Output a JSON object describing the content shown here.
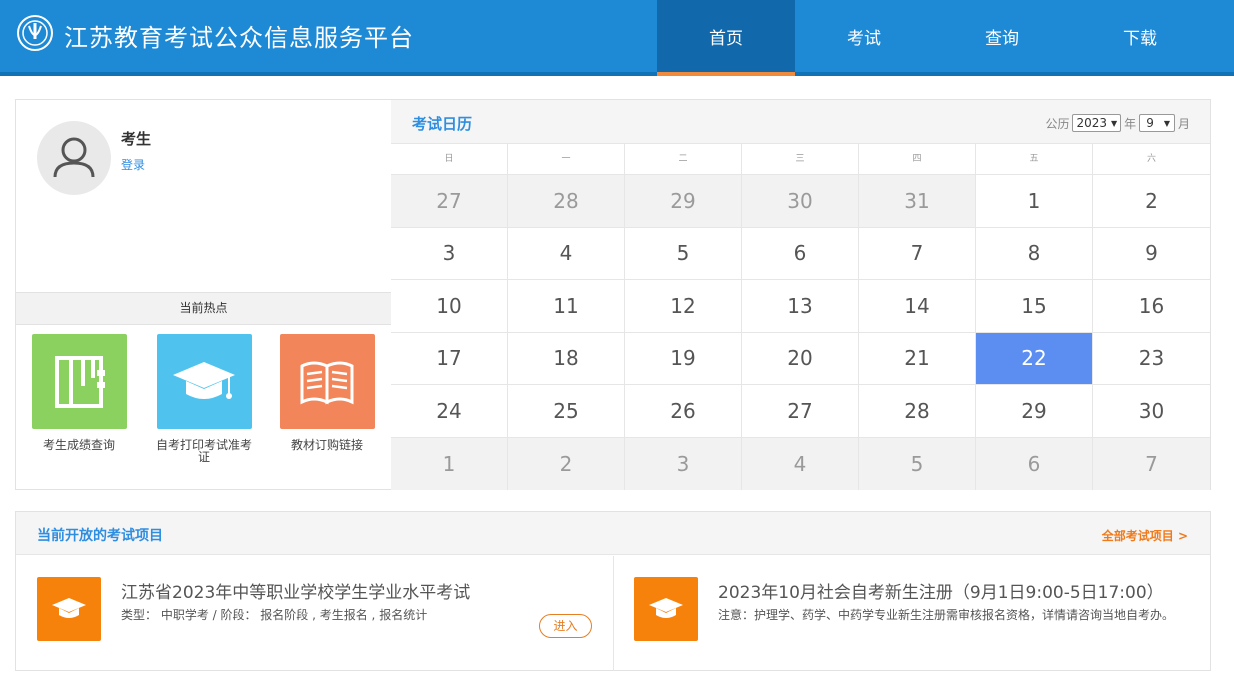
{
  "header": {
    "site_title": "江苏教育考试公众信息服务平台",
    "nav": [
      "首页",
      "考试",
      "查询",
      "下载"
    ],
    "active_nav": "首页"
  },
  "user": {
    "name": "考生",
    "login_label": "登录"
  },
  "hot": {
    "title": "当前热点",
    "items": [
      {
        "label": "考生成绩查询",
        "icon": "notebook-icon",
        "color": "#8bd15f"
      },
      {
        "label": "自考打印考试准考证",
        "icon": "graduation-cap-icon",
        "color": "#4fc3ee"
      },
      {
        "label": "教材订购链接",
        "icon": "open-book-icon",
        "color": "#f2865a"
      }
    ]
  },
  "calendar": {
    "title": "考试日历",
    "era_label": "公历",
    "year": "2023",
    "year_unit": "年",
    "month": "9",
    "month_unit": "月",
    "weekdays": [
      "日",
      "一",
      "二",
      "三",
      "四",
      "五",
      "六"
    ],
    "days": [
      {
        "d": "27",
        "other": true
      },
      {
        "d": "28",
        "other": true
      },
      {
        "d": "29",
        "other": true
      },
      {
        "d": "30",
        "other": true
      },
      {
        "d": "31",
        "other": true
      },
      {
        "d": "1"
      },
      {
        "d": "2"
      },
      {
        "d": "3"
      },
      {
        "d": "4"
      },
      {
        "d": "5"
      },
      {
        "d": "6"
      },
      {
        "d": "7"
      },
      {
        "d": "8"
      },
      {
        "d": "9"
      },
      {
        "d": "10"
      },
      {
        "d": "11"
      },
      {
        "d": "12"
      },
      {
        "d": "13"
      },
      {
        "d": "14"
      },
      {
        "d": "15"
      },
      {
        "d": "16"
      },
      {
        "d": "17"
      },
      {
        "d": "18"
      },
      {
        "d": "19"
      },
      {
        "d": "20"
      },
      {
        "d": "21"
      },
      {
        "d": "22",
        "today": true
      },
      {
        "d": "23"
      },
      {
        "d": "24"
      },
      {
        "d": "25"
      },
      {
        "d": "26"
      },
      {
        "d": "27"
      },
      {
        "d": "28"
      },
      {
        "d": "29"
      },
      {
        "d": "30"
      },
      {
        "d": "1",
        "other": true
      },
      {
        "d": "2",
        "other": true
      },
      {
        "d": "3",
        "other": true
      },
      {
        "d": "4",
        "other": true
      },
      {
        "d": "5",
        "other": true
      },
      {
        "d": "6",
        "other": true
      },
      {
        "d": "7",
        "other": true
      }
    ]
  },
  "projects": {
    "title": "当前开放的考试项目",
    "all_label": "全部考试项目 >",
    "items": [
      {
        "name": "江苏省2023年中等职业学校学生学业水平考试",
        "desc": "类型： 中职学考 / 阶段： 报名阶段 , 考生报名 , 报名统计",
        "button": "进入"
      },
      {
        "name": "2023年10月社会自考新生注册（9月1日9:00-5日17:00）",
        "desc": "注意：护理学、药学、中药学专业新生注册需审核报名资格，详情请咨询当地自考办。"
      }
    ]
  }
}
